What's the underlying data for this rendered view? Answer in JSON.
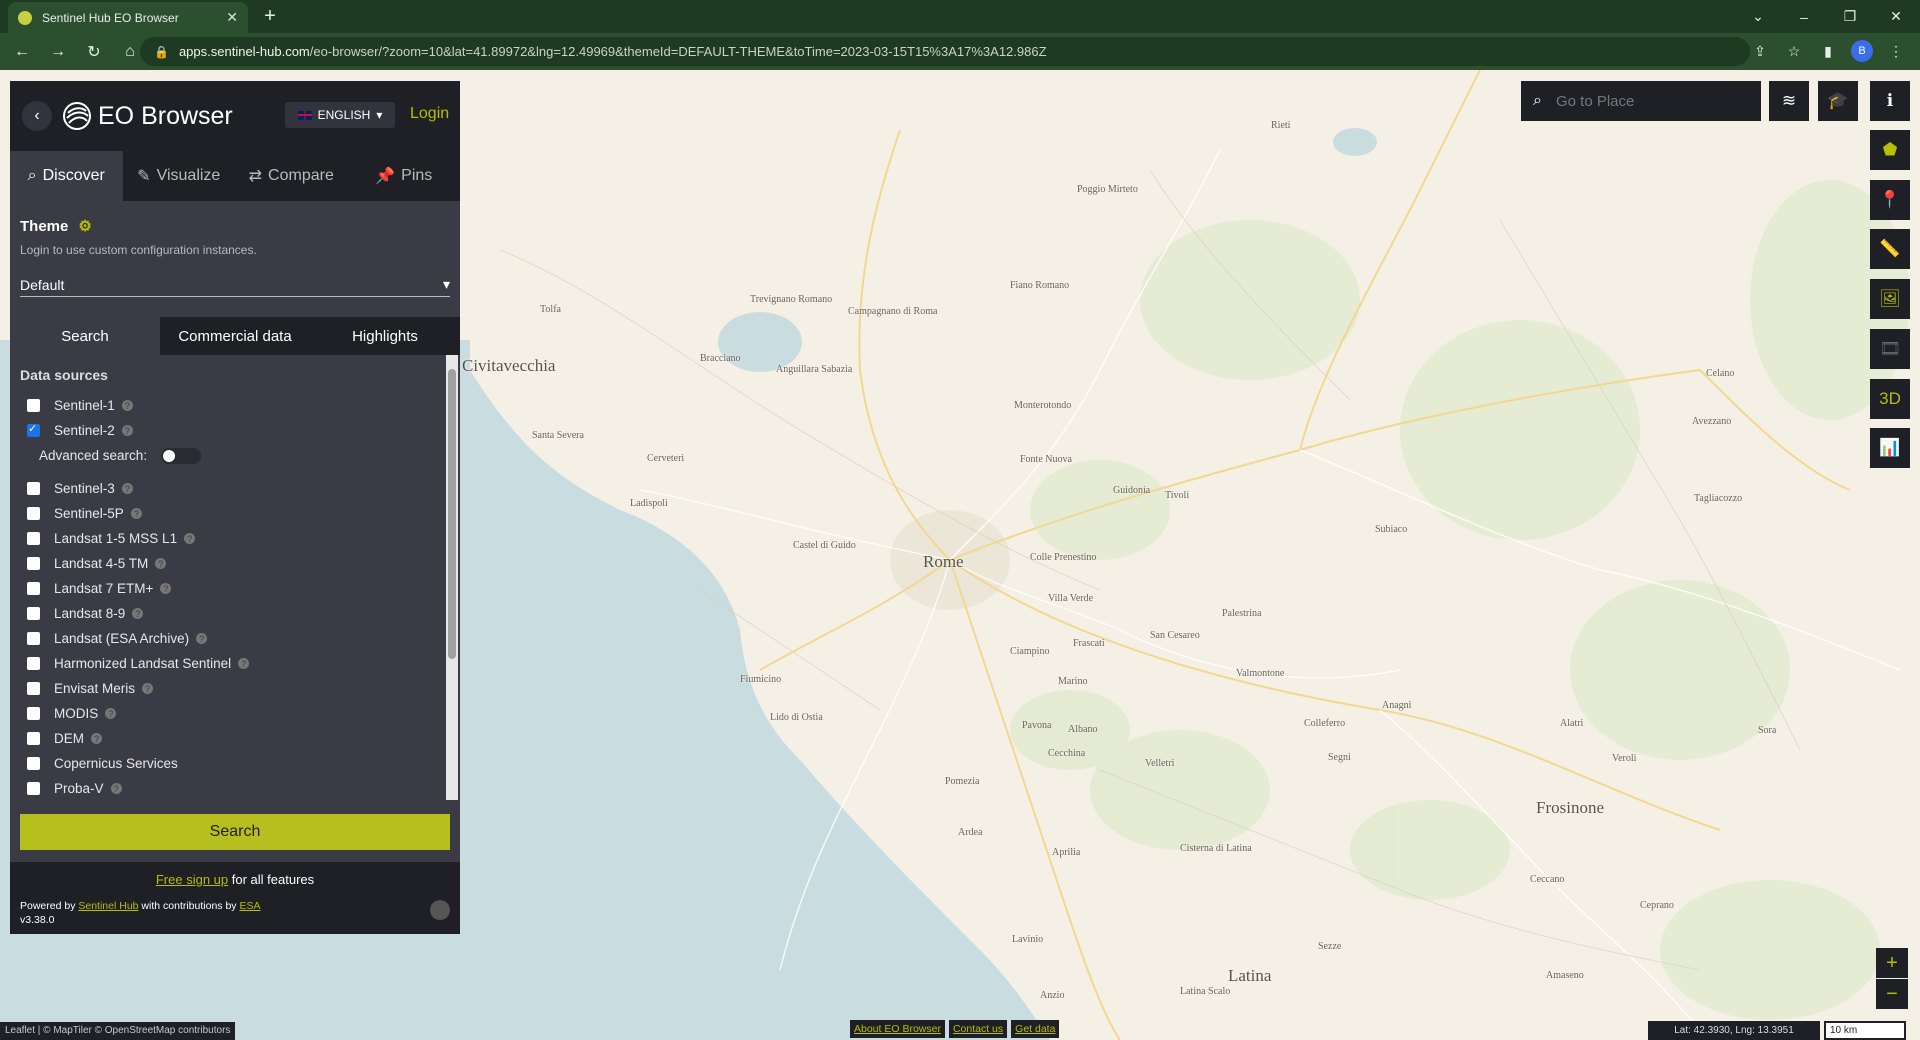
{
  "browser": {
    "tab_title": "Sentinel Hub EO Browser",
    "url_host": "apps.sentinel-hub.com",
    "url_path": "/eo-browser/?zoom=10&lat=41.89972&lng=12.49969&themeId=DEFAULT-THEME&toTime=2023-03-15T15%3A17%3A12.986Z",
    "profile_initial": "B"
  },
  "header": {
    "app_title": "EO Browser",
    "language": "ENGLISH",
    "login": "Login"
  },
  "main_tabs": [
    {
      "label": "Discover",
      "icon": "search-icon"
    },
    {
      "label": "Visualize",
      "icon": "brush-icon"
    },
    {
      "label": "Compare",
      "icon": "compare-icon"
    },
    {
      "label": "Pins",
      "icon": "pin-icon"
    }
  ],
  "theme": {
    "title": "Theme",
    "hint": "Login to use custom configuration instances.",
    "selected": "Default"
  },
  "sub_tabs": [
    "Search",
    "Commercial data",
    "Highlights"
  ],
  "data_sources": {
    "title": "Data sources",
    "advanced_label": "Advanced search:",
    "items": [
      {
        "label": "Sentinel-1",
        "checked": false
      },
      {
        "label": "Sentinel-2",
        "checked": true
      },
      {
        "label": "Sentinel-3",
        "checked": false
      },
      {
        "label": "Sentinel-5P",
        "checked": false
      },
      {
        "label": "Landsat 1-5 MSS L1",
        "checked": false
      },
      {
        "label": "Landsat 4-5 TM",
        "checked": false
      },
      {
        "label": "Landsat 7 ETM+",
        "checked": false
      },
      {
        "label": "Landsat 8-9",
        "checked": false
      },
      {
        "label": "Landsat (ESA Archive)",
        "checked": false
      },
      {
        "label": "Harmonized Landsat Sentinel",
        "checked": false
      },
      {
        "label": "Envisat Meris",
        "checked": false
      },
      {
        "label": "MODIS",
        "checked": false
      },
      {
        "label": "DEM",
        "checked": false
      },
      {
        "label": "Copernicus Services",
        "checked": false
      },
      {
        "label": "Proba-V",
        "checked": false
      }
    ]
  },
  "search_button": "Search",
  "footer": {
    "signup_link": "Free sign up",
    "signup_rest": "for all features",
    "powered_prefix": "Powered by",
    "powered_link": "Sentinel Hub",
    "powered_mid": "with contributions by",
    "powered_esa": "ESA",
    "version": "v3.38.0"
  },
  "map": {
    "goto_placeholder": "Go to Place",
    "places": [
      {
        "name": "Rome",
        "size": "big"
      },
      {
        "name": "Latina",
        "size": "big"
      },
      {
        "name": "Frosinone",
        "size": "big"
      },
      {
        "name": "Civitavecchia",
        "size": "big"
      },
      {
        "name": "Tivoli",
        "size": "small"
      },
      {
        "name": "Fiumicino",
        "size": "small"
      },
      {
        "name": "Lido di Ostia",
        "size": "small"
      },
      {
        "name": "Anzio",
        "size": "small"
      },
      {
        "name": "Aprilia",
        "size": "small"
      },
      {
        "name": "Velletri",
        "size": "small"
      },
      {
        "name": "Pomezia",
        "size": "small"
      },
      {
        "name": "Ladispoli",
        "size": "small"
      },
      {
        "name": "Cerveteri",
        "size": "small"
      },
      {
        "name": "Bracciano",
        "size": "small"
      },
      {
        "name": "Frascati",
        "size": "small"
      },
      {
        "name": "Palestrina",
        "size": "small"
      },
      {
        "name": "Subiaco",
        "size": "small"
      },
      {
        "name": "Anagni",
        "size": "small"
      },
      {
        "name": "Colleferro",
        "size": "small"
      },
      {
        "name": "Segni",
        "size": "small"
      },
      {
        "name": "Monterotondo",
        "size": "small"
      },
      {
        "name": "Fonte Nuova",
        "size": "small"
      },
      {
        "name": "Guidonia",
        "size": "small"
      },
      {
        "name": "Ciampino",
        "size": "small"
      },
      {
        "name": "Marino",
        "size": "small"
      },
      {
        "name": "Albano",
        "size": "small"
      },
      {
        "name": "Ardea",
        "size": "small"
      },
      {
        "name": "Cisterna di Latina",
        "size": "small"
      },
      {
        "name": "Sezze",
        "size": "small"
      },
      {
        "name": "Ceccano",
        "size": "small"
      },
      {
        "name": "Alatri",
        "size": "small"
      },
      {
        "name": "Veroli",
        "size": "small"
      },
      {
        "name": "Sora",
        "size": "small"
      },
      {
        "name": "Avezzano",
        "size": "small"
      },
      {
        "name": "Tagliacozzo",
        "size": "small"
      },
      {
        "name": "Celano",
        "size": "small"
      },
      {
        "name": "Poggio Mirteto",
        "size": "small"
      },
      {
        "name": "Fiano Romano",
        "size": "small"
      },
      {
        "name": "Rieti",
        "size": "small"
      },
      {
        "name": "Campagnano di Roma",
        "size": "small"
      },
      {
        "name": "Anguillara Sabazia",
        "size": "small"
      },
      {
        "name": "Trevignano Romano",
        "size": "small"
      },
      {
        "name": "Santa Severa",
        "size": "small"
      },
      {
        "name": "Tolfa",
        "size": "small"
      },
      {
        "name": "Castel di Guido",
        "size": "small"
      },
      {
        "name": "Valmontone",
        "size": "small"
      },
      {
        "name": "San Cesareo",
        "size": "small"
      },
      {
        "name": "Villa Verde",
        "size": "small"
      },
      {
        "name": "Colle Prenestino",
        "size": "small"
      },
      {
        "name": "Pavona",
        "size": "small"
      },
      {
        "name": "Cecchina",
        "size": "small"
      },
      {
        "name": "Lavinio",
        "size": "small"
      },
      {
        "name": "Ceprano",
        "size": "small"
      },
      {
        "name": "Amaseno",
        "size": "small"
      },
      {
        "name": "Latina Scalo",
        "size": "small"
      }
    ]
  },
  "map_footer": {
    "attribution": "Leaflet | © MapTiler © OpenStreetMap contributors",
    "links": [
      "About EO Browser",
      "Contact us",
      "Get data"
    ],
    "coords": "Lat: 42.3930, Lng: 13.3951",
    "scale": "10 km",
    "maptiler": "maptiler"
  },
  "colors": {
    "accent": "#b6bf1d",
    "panel": "#3b3b45",
    "panel_dark": "#1f1f26",
    "sea": "#c9dde0",
    "land": "#f4f0e6"
  }
}
